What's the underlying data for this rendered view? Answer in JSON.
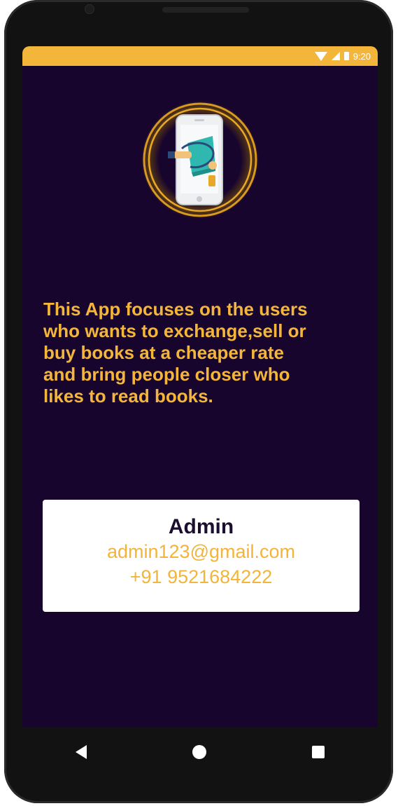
{
  "status_bar": {
    "time": "9:20",
    "icons": [
      "wifi-icon",
      "signal-icon",
      "battery-icon"
    ]
  },
  "app": {
    "logo_icon": "phone-books-logo-icon",
    "description": "This App focuses on the users\nwho wants to exchange,sell or\nbuy  books at a cheaper rate\nand bring people closer who\nlikes to read books."
  },
  "contact": {
    "name": "Admin",
    "email": "admin123@gmail.com",
    "phone": "+91 9521684222"
  },
  "navigation": {
    "icons": [
      "back-icon",
      "home-icon",
      "recents-icon"
    ]
  },
  "colors": {
    "accent": "#f4b63a",
    "background": "#18052e",
    "card": "#ffffff",
    "name_text": "#1c0f2e"
  }
}
